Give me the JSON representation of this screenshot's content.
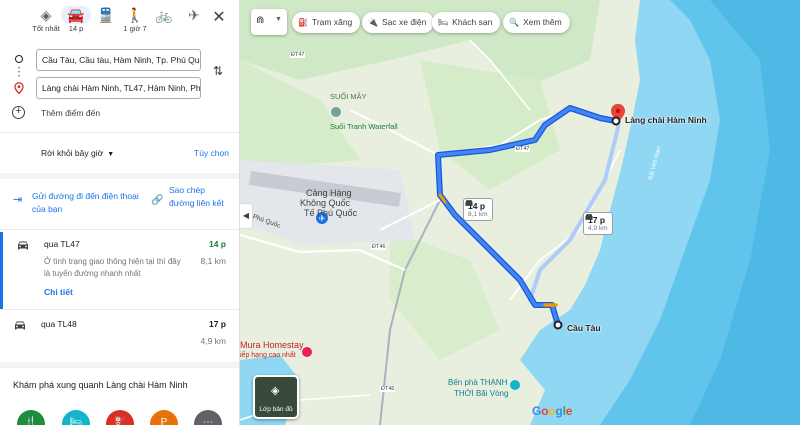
{
  "travel_modes": [
    {
      "name": "best",
      "label": "Tốt nhất",
      "icon": "diamond-route-icon"
    },
    {
      "name": "car",
      "label": "14 p",
      "icon": "car-icon",
      "active": true
    },
    {
      "name": "transit",
      "label": "",
      "icon": "train-icon"
    },
    {
      "name": "walk",
      "label": "1 giờ 7",
      "icon": "walk-icon"
    },
    {
      "name": "bike",
      "label": "",
      "icon": "bike-icon"
    },
    {
      "name": "flight",
      "label": "",
      "icon": "plane-icon"
    }
  ],
  "origin": "Cầu Tàu, Cầu tàu, Hàm Ninh, Tp. Phú Quốc",
  "destination": "Làng chài Hàm Ninh, TL47, Hàm Ninh, Phú Quốc",
  "add_stop": "Thêm điểm đến",
  "depart_label": "Rời khỏi bây giờ",
  "options_label": "Tùy chọn",
  "send_to_phone": "Gửi đường đi đến điện thoại của bạn",
  "copy_link": "Sao chép đường liên kết",
  "routes": [
    {
      "via": "qua TL47",
      "duration": "14 p",
      "distance": "8,1 km",
      "description": "Ở tình trạng giao thông hiện tại thì đây là tuyến đường nhanh nhất",
      "detail_link": "Chi tiết",
      "selected": true,
      "duration_color": "#188038"
    },
    {
      "via": "qua TL48",
      "duration": "17 p",
      "distance": "4,9 km",
      "selected": false,
      "duration_color": "#202124"
    }
  ],
  "explore_title": "Khám phá xung quanh Làng chài Hàm Ninh",
  "explore_icons": [
    {
      "icon": "restaurant-icon",
      "color": "#1e8e3e"
    },
    {
      "icon": "hotel-icon",
      "color": "#12b5cb"
    },
    {
      "icon": "gas-station-icon",
      "color": "#d93025"
    },
    {
      "icon": "parking-icon",
      "color": "#e8710a"
    },
    {
      "icon": "more-icon",
      "color": "#5f6368"
    }
  ],
  "map_chips": [
    {
      "label": "Trạm xăng",
      "icon": "gas-pump-icon"
    },
    {
      "label": "Sạc xe điện",
      "icon": "ev-charger-icon"
    },
    {
      "label": "Khách sạn",
      "icon": "bed-icon"
    },
    {
      "label": "Xem thêm",
      "icon": "search-icon"
    }
  ],
  "route_bubbles": [
    {
      "duration": "14 p",
      "distance": "8,1 km"
    },
    {
      "duration": "17 p",
      "distance": "4,9 km"
    }
  ],
  "map_labels": {
    "destination": "Làng chài Hàm Ninh",
    "origin": "Cầu Tàu",
    "suoi_may": "SUỐI MÂY",
    "waterfall": "Suối Tranh Waterfall",
    "airport_1": "Cảng Hàng",
    "airport_2": "Không Quốc",
    "airport_3": "Tế Phú Quốc",
    "homestay": "Mura Homestay",
    "homestay_sub": "iếp hạng cao nhất",
    "ferry_1": "Bến phà THẠNH",
    "ferry_2": "THỚI Bãi Vòng",
    "phu_quoc_road": "Phú Quốc",
    "hamninh_vertical": "Bãi Việt Nam",
    "road_dt47a": "ĐT47",
    "road_dt47b": "ĐT47",
    "road_dt46a": "ĐT46",
    "road_dt46b": "ĐT46",
    "layer_button": "Lớp bản đồ",
    "google": "Google"
  },
  "colors": {
    "route_primary": "#1a73e8",
    "route_alt": "#aecbfa",
    "sea": "#7fd1f2",
    "land": "#e8f0e0"
  }
}
